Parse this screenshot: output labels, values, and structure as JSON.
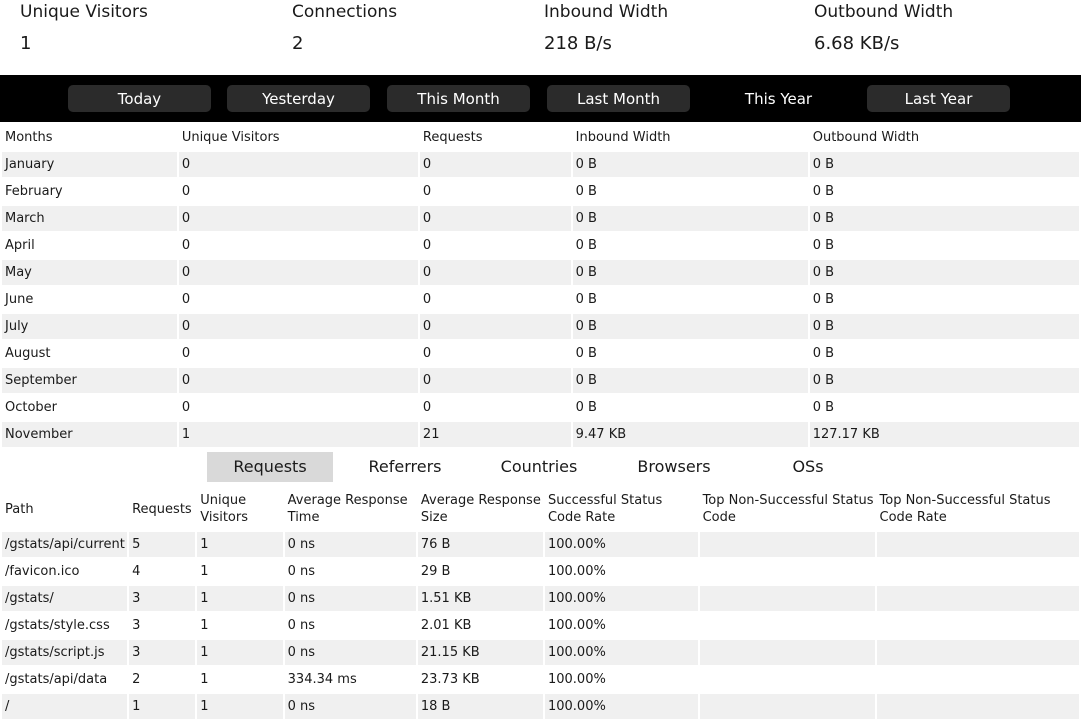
{
  "summary": [
    {
      "label": "Unique Visitors",
      "value": "1"
    },
    {
      "label": "Connections",
      "value": "2"
    },
    {
      "label": "Inbound Width",
      "value": "218 B/s"
    },
    {
      "label": "Outbound Width",
      "value": "6.68 KB/s"
    }
  ],
  "ranges": [
    {
      "label": "Today",
      "active": false
    },
    {
      "label": "Yesterday",
      "active": false
    },
    {
      "label": "This Month",
      "active": false
    },
    {
      "label": "Last Month",
      "active": false
    },
    {
      "label": "This Year",
      "active": true
    },
    {
      "label": "Last Year",
      "active": false
    }
  ],
  "months_table": {
    "headers": [
      "Months",
      "Unique Visitors",
      "Requests",
      "Inbound Width",
      "Outbound Width"
    ],
    "rows": [
      [
        "January",
        "0",
        "0",
        "0 B",
        "0 B"
      ],
      [
        "February",
        "0",
        "0",
        "0 B",
        "0 B"
      ],
      [
        "March",
        "0",
        "0",
        "0 B",
        "0 B"
      ],
      [
        "April",
        "0",
        "0",
        "0 B",
        "0 B"
      ],
      [
        "May",
        "0",
        "0",
        "0 B",
        "0 B"
      ],
      [
        "June",
        "0",
        "0",
        "0 B",
        "0 B"
      ],
      [
        "July",
        "0",
        "0",
        "0 B",
        "0 B"
      ],
      [
        "August",
        "0",
        "0",
        "0 B",
        "0 B"
      ],
      [
        "September",
        "0",
        "0",
        "0 B",
        "0 B"
      ],
      [
        "October",
        "0",
        "0",
        "0 B",
        "0 B"
      ],
      [
        "November",
        "1",
        "21",
        "9.47 KB",
        "127.17 KB"
      ]
    ]
  },
  "tabs": [
    {
      "label": "Requests",
      "active": true
    },
    {
      "label": "Referrers",
      "active": false
    },
    {
      "label": "Countries",
      "active": false
    },
    {
      "label": "Browsers",
      "active": false
    },
    {
      "label": "OSs",
      "active": false
    }
  ],
  "paths_table": {
    "headers": [
      "Path",
      "Requests",
      "Unique Visitors",
      "Average Response Time",
      "Average Response Size",
      "Successful Status Code Rate",
      "Top Non-Successful Status Code",
      "Top Non-Successful Status Code Rate"
    ],
    "rows": [
      [
        "/gstats/api/current",
        "5",
        "1",
        "0 ns",
        "76 B",
        "100.00%",
        "",
        ""
      ],
      [
        "/favicon.ico",
        "4",
        "1",
        "0 ns",
        "29 B",
        "100.00%",
        "",
        ""
      ],
      [
        "/gstats/",
        "3",
        "1",
        "0 ns",
        "1.51 KB",
        "100.00%",
        "",
        ""
      ],
      [
        "/gstats/style.css",
        "3",
        "1",
        "0 ns",
        "2.01 KB",
        "100.00%",
        "",
        ""
      ],
      [
        "/gstats/script.js",
        "3",
        "1",
        "0 ns",
        "21.15 KB",
        "100.00%",
        "",
        ""
      ],
      [
        "/gstats/api/data",
        "2",
        "1",
        "334.34 ms",
        "23.73 KB",
        "100.00%",
        "",
        ""
      ],
      [
        "/",
        "1",
        "1",
        "0 ns",
        "18 B",
        "100.00%",
        "",
        ""
      ]
    ]
  }
}
